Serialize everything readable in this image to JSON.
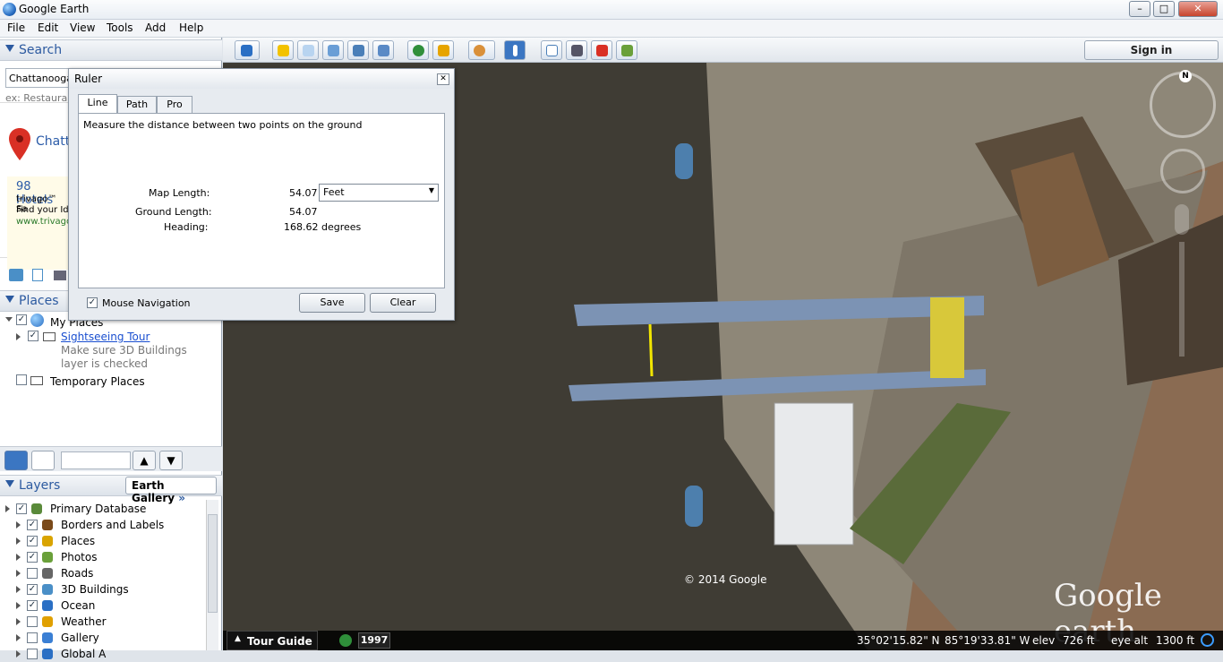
{
  "window": {
    "title": "Google Earth",
    "minimize": "–",
    "maximize": "□",
    "close": "✕"
  },
  "menu": [
    "File",
    "Edit",
    "View",
    "Tools",
    "Add",
    "Help"
  ],
  "search": {
    "header": "Search",
    "value": "Chattanooga,",
    "hint": "ex: Restauran",
    "result_title": "Chatt",
    "ad": {
      "title": "98 Hotels",
      "line1": "trivago™ Sa",
      "line2": "Find your Id",
      "url": "www.trivago."
    }
  },
  "places": {
    "header": "Places",
    "items": [
      {
        "label": "My Places",
        "checked": true
      },
      {
        "label": "Sightseeing Tour",
        "checked": true,
        "link": true
      },
      {
        "label": "Make sure 3D Buildings"
      },
      {
        "label": "layer is checked"
      },
      {
        "label": "Temporary Places",
        "checked": false
      }
    ]
  },
  "layers": {
    "header": "Layers",
    "gallery_button": "Earth Gallery",
    "items": [
      {
        "label": "Primary Database",
        "checked": true,
        "icon": "database-icon",
        "color": "#5a8a3a"
      },
      {
        "label": "Borders and Labels",
        "checked": true,
        "icon": "flag-icon",
        "color": "#7a4a1a"
      },
      {
        "label": "Places",
        "checked": true,
        "icon": "place-square-icon",
        "color": "#d9a400"
      },
      {
        "label": "Photos",
        "checked": true,
        "icon": "photo-icon",
        "color": "#6aa03a"
      },
      {
        "label": "Roads",
        "checked": false,
        "icon": "road-icon",
        "color": "#666666"
      },
      {
        "label": "3D Buildings",
        "checked": true,
        "icon": "building-icon",
        "color": "#4a8fc7"
      },
      {
        "label": "Ocean",
        "checked": true,
        "icon": "globe-icon",
        "color": "#2a6fc4"
      },
      {
        "label": "Weather",
        "checked": false,
        "icon": "sun-icon",
        "color": "#e0a000"
      },
      {
        "label": "Gallery",
        "checked": false,
        "icon": "star-icon",
        "color": "#3a7fd4"
      },
      {
        "label": "Global A",
        "checked": false,
        "icon": "globe-icon",
        "color": "#2a6fc4"
      }
    ]
  },
  "toolbar": {
    "signin": "Sign in"
  },
  "ruler": {
    "title": "Ruler",
    "tabs": [
      "Line",
      "Path",
      "Pro"
    ],
    "active_tab": "Line",
    "description": "Measure the distance between two points on the ground",
    "map_length_label": "Map Length:",
    "map_length_value": "54.07",
    "unit": "Feet",
    "ground_length_label": "Ground Length:",
    "ground_length_value": "54.07",
    "heading_label": "Heading:",
    "heading_value": "168.62 degrees",
    "mouse_nav_label": "Mouse Navigation",
    "mouse_nav_checked": true,
    "save": "Save",
    "clear": "Clear"
  },
  "map": {
    "copyright": "© 2014 Google",
    "watermark": "Google earth",
    "compass_n": "N"
  },
  "status": {
    "tour_guide": "Tour Guide",
    "year": "1997",
    "lat": "35°02'15.82\" N",
    "lon": "85°19'33.81\" W",
    "elev_label": "elev",
    "elev": "726 ft",
    "eye_alt_label": "eye alt",
    "eye_alt": "1300 ft"
  }
}
